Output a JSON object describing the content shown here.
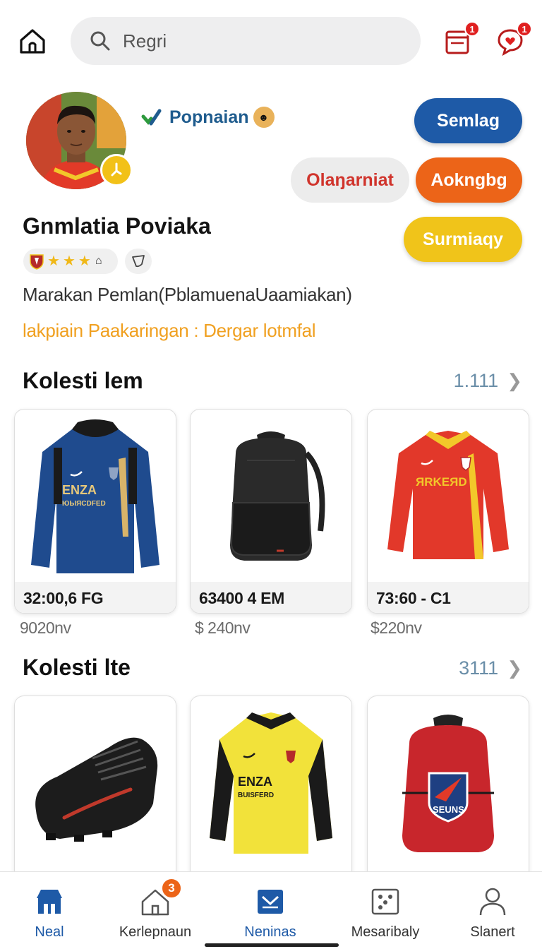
{
  "header": {
    "search_placeholder": "Regri",
    "notifications_badge": "1",
    "messages_badge": "1"
  },
  "profile": {
    "brand_name": "Popnaian",
    "name": "Gnmlatia Poviaka",
    "rating_stars": 3,
    "subtitle": "Marakan Pemlan(PblamuenaUaamiakan)",
    "promo": "lakpiain Paakaringan : Dergar lotmfal",
    "actions": {
      "primary": "Semlag",
      "secondary": "Olaŋarniat",
      "orange": "Aokngbg",
      "yellow": "Surmiaqy"
    }
  },
  "sections": [
    {
      "title": "Kolesti lem",
      "count": "1.111",
      "items": [
        {
          "code": "32:00,6 FG",
          "price": "9020nv",
          "image": "blue-jersey"
        },
        {
          "code": "63400 4 EM",
          "price": "$ 240nv",
          "image": "black-backpack"
        },
        {
          "code": "73:60 - C1",
          "price": "$220nv",
          "image": "red-jersey"
        }
      ]
    },
    {
      "title": "Kolesti lte",
      "count": "3111",
      "items": [
        {
          "image": "black-boot"
        },
        {
          "image": "yellow-jersey"
        },
        {
          "image": "red-backpack"
        }
      ]
    }
  ],
  "bottom_nav": [
    {
      "label": "Neal",
      "icon": "shop-icon",
      "active": true
    },
    {
      "label": "Kerlepnaun",
      "icon": "house-icon",
      "badge": "3"
    },
    {
      "label": "Neninas",
      "icon": "mail-icon",
      "active": true
    },
    {
      "label": "Mesaribaly",
      "icon": "dice-icon"
    },
    {
      "label": "Slanert",
      "icon": "person-icon"
    }
  ],
  "colors": {
    "primary_blue": "#1e5aa7",
    "orange": "#ec6418",
    "yellow": "#f0c41a",
    "red_text": "#d0342c",
    "promo": "#f0a020",
    "count_blue": "#6a8ea8"
  }
}
